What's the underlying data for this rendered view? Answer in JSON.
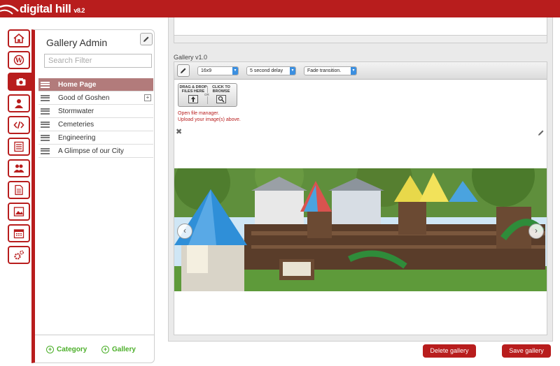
{
  "app": {
    "name": "digital hill",
    "version": "v8.2"
  },
  "rail": {
    "items": [
      {
        "icon": "home-icon"
      },
      {
        "icon": "wordpress-icon"
      },
      {
        "icon": "camera-icon",
        "active": true
      },
      {
        "icon": "users-icon"
      },
      {
        "icon": "code-icon"
      },
      {
        "icon": "list-icon"
      },
      {
        "icon": "group-icon"
      },
      {
        "icon": "document-icon"
      },
      {
        "icon": "image-icon"
      },
      {
        "icon": "calendar-icon"
      },
      {
        "icon": "gears-icon"
      }
    ]
  },
  "sidebar": {
    "title": "Gallery Admin",
    "search_placeholder": "Search Filter",
    "items": [
      {
        "label": "Home Page",
        "selected": true
      },
      {
        "label": "Good of Goshen",
        "expandable": true
      },
      {
        "label": "Stormwater"
      },
      {
        "label": "Cemeteries"
      },
      {
        "label": "Engineering"
      },
      {
        "label": "A Glimpse of our City"
      }
    ],
    "add_category": "Category",
    "add_gallery": "Gallery"
  },
  "gallery": {
    "label": "Gallery v1.0",
    "aspect": "16x9",
    "delay": "5 second delay",
    "transition": "Fade transition.",
    "drop_label": "DRAG & DROP FILES HERE",
    "or_label": "OR",
    "browse_label": "CLICK TO BROWSE",
    "open_file_manager": "Open file manager.",
    "upload_hint": "Upload your image(s) above."
  },
  "actions": {
    "delete": "Delete gallery",
    "save": "Save gallery"
  },
  "colors": {
    "brand": "#b81d1d",
    "selected_row": "#b27b7b",
    "add_green": "#4caf2a",
    "select_arrow": "#3b8fe0"
  }
}
